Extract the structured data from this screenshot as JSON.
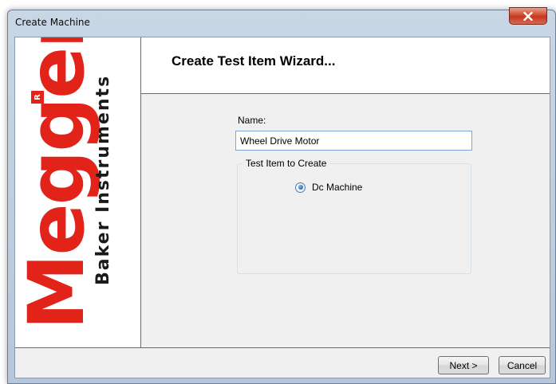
{
  "window": {
    "title": "Create Machine"
  },
  "logo": {
    "brand": "Megger",
    "registered": "R",
    "subtitle": "Baker Instruments",
    "brand_color": "#e2231a"
  },
  "wizard": {
    "title": "Create Test Item Wizard..."
  },
  "form": {
    "name_label": "Name:",
    "name_value": "Wheel Drive Motor",
    "group_label": "Test Item to Create",
    "options": [
      {
        "label": "Dc Machine",
        "selected": true
      }
    ]
  },
  "buttons": {
    "next": "Next >",
    "cancel": "Cancel"
  },
  "icons": {
    "close": "close-icon"
  }
}
